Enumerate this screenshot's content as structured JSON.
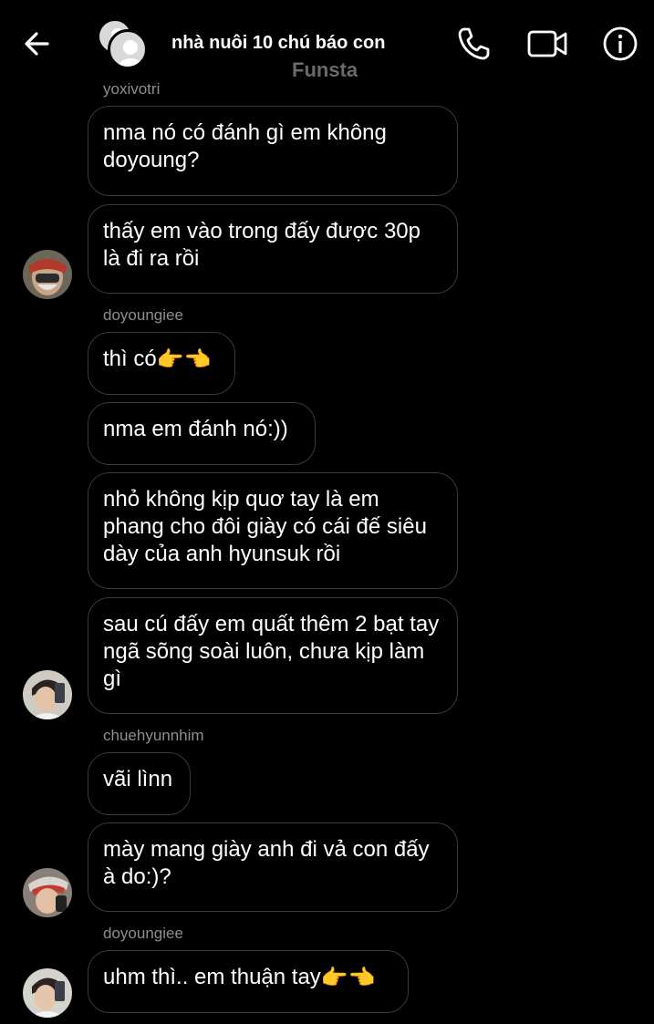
{
  "header": {
    "title": "nhà nuôi 10 chú báo con",
    "subtitle": "Funsta",
    "back_icon": "arrow-left-icon",
    "call_icon": "phone-icon",
    "video_icon": "video-camera-icon",
    "info_icon": "info-icon"
  },
  "messages": [
    {
      "sender": "yoxivotri"
    },
    {
      "text": "nma nó có đánh gì em không doyoung?"
    },
    {
      "text": "thấy em vào trong đấy được 30p là đi ra rồi"
    },
    {
      "sender": "doyoungiee"
    },
    {
      "text": "thì có",
      "emoji": "👉👈"
    },
    {
      "text": "nma em đánh nó:))"
    },
    {
      "text": "nhỏ không kịp quơ tay là em phang cho đôi giày có cái đế siêu dày của anh hyunsuk rồi"
    },
    {
      "text": "sau cú đấy em quất thêm 2 bạt tay ngã sõng soài luôn, chưa kịp làm gì"
    },
    {
      "sender": "chuehyunnhim"
    },
    {
      "text": "vãi lìnn"
    },
    {
      "text": "mày mang giày anh đi vả con đấy à do:)?"
    },
    {
      "sender": "doyoungiee"
    },
    {
      "text": "uhm thì.. em thuận tay",
      "emoji": "👉👈"
    }
  ]
}
